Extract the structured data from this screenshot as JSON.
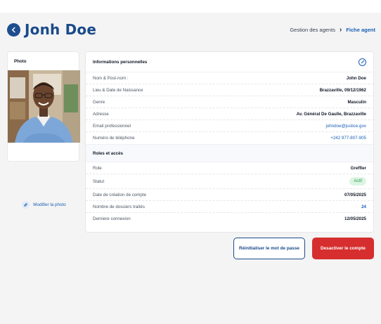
{
  "header": {
    "title": "Jonh Doe",
    "breadcrumb": {
      "parent": "Gestion  des agents",
      "separator": "›",
      "current": "Fiche agent"
    }
  },
  "photo_card": {
    "title": "Photo",
    "modify_label": "Modifier la photo"
  },
  "personal_info": {
    "title": "Informations personnelles",
    "rows": [
      {
        "label": "Nom & Post-nom :",
        "value": "John Doe"
      },
      {
        "label": "Lieu & Date de Naissance",
        "value": "Brazzaville, 09/12/1962"
      },
      {
        "label": "Genre",
        "value": "Masculin"
      },
      {
        "label": "Adresse",
        "value": "Av. Général De Gaulle, Brazzaville"
      },
      {
        "label": "Email professionnel",
        "value": "johndoe@justice.gov"
      },
      {
        "label": "Numéro de téléphone",
        "value": "+242 977-807-905"
      }
    ]
  },
  "roles": {
    "title": "Roles et accès",
    "rows": [
      {
        "label": "Role",
        "value": "Greffier"
      },
      {
        "label": "Statut",
        "value": "Actif"
      },
      {
        "label": "Date de création de compte",
        "value": "07/05/2025"
      },
      {
        "label": "Nombre de dossiers traités",
        "value": "24"
      },
      {
        "label": "Derniere connexion",
        "value": "12/05/2025"
      }
    ]
  },
  "actions": {
    "reset_password": "Réinitialiser le mot de passe",
    "deactivate": "Desactiver le compte"
  },
  "colors": {
    "primary": "#1a4a8a",
    "link": "#1a5fb4",
    "danger": "#d62e2e",
    "success_bg": "#dcf5e3",
    "success_text": "#2e9b56"
  }
}
